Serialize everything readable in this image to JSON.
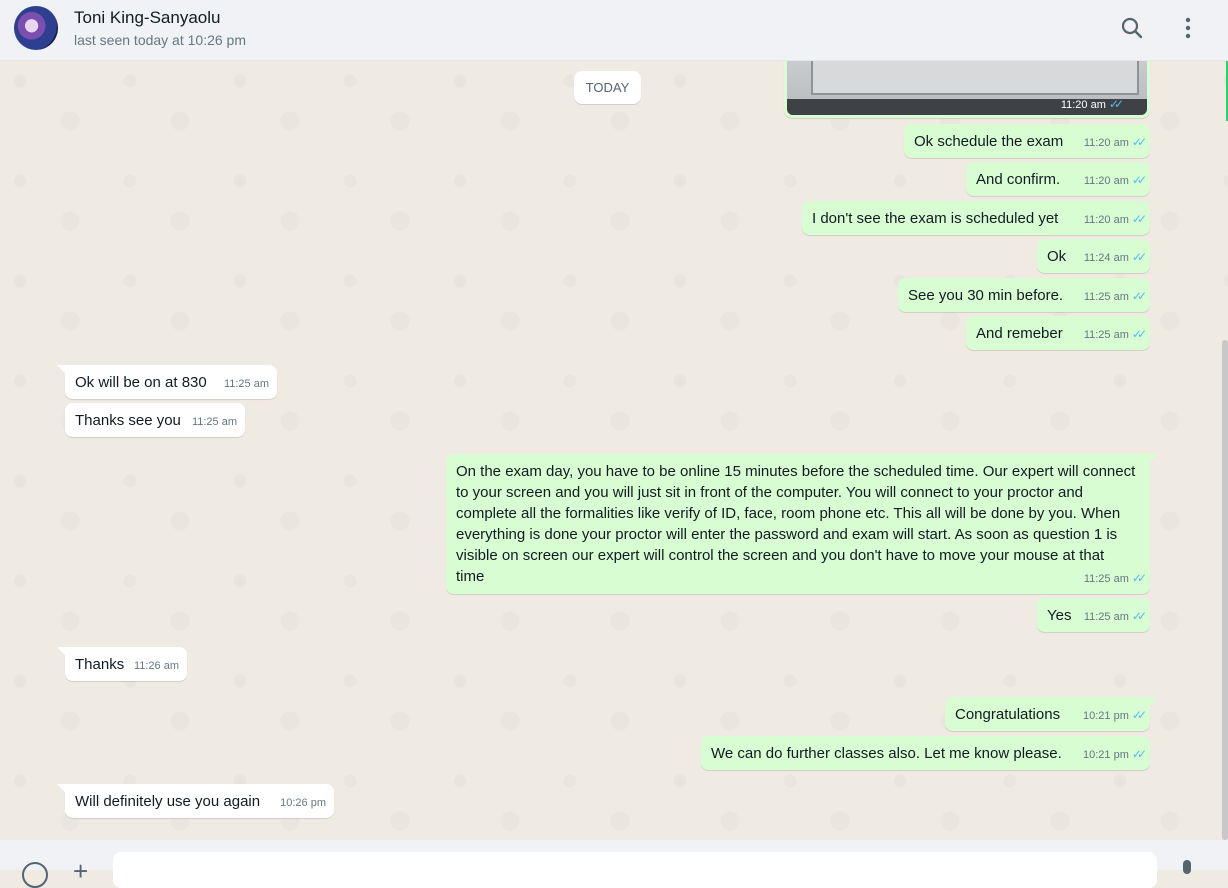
{
  "header": {
    "contact_name": "Toni King-Sanyaolu",
    "status": "last seen today at 10:26 pm"
  },
  "icons": {
    "search": "search-icon",
    "menu": "kebab-menu-icon",
    "ticks": "double-check-icon"
  },
  "colors": {
    "outgoing_bubble": "#d9fdd3",
    "incoming_bubble": "#ffffff",
    "read_ticks": "#53bdeb",
    "chat_bg": "#efeae2"
  },
  "chat": {
    "day_label": "TODAY",
    "image_time": "11:20 am",
    "messages": [
      {
        "dir": "out",
        "text": "Ok schedule the exam",
        "time": "11:20 am"
      },
      {
        "dir": "out",
        "text": "And confirm.",
        "time": "11:20 am"
      },
      {
        "dir": "out",
        "text": "I don't see the exam is scheduled yet",
        "time": "11:20 am"
      },
      {
        "dir": "out",
        "text": "Ok",
        "time": "11:24 am"
      },
      {
        "dir": "out",
        "text": "See you 30 min before.",
        "time": "11:25 am"
      },
      {
        "dir": "out",
        "text": "And remeber",
        "time": "11:25 am"
      },
      {
        "dir": "in",
        "text": "Ok will be on at 830",
        "time": "11:25 am"
      },
      {
        "dir": "in",
        "text": "Thanks see you",
        "time": "11:25 am"
      },
      {
        "dir": "out",
        "text": "On the exam day, you have to be online 15 minutes before the scheduled time. Our expert will connect to your screen and you will just sit in front of the computer. You will connect to your proctor and complete all the formalities like verify of ID, face, room phone etc. This all will be done by you. When everything is done your proctor will enter the password and exam will start. As soon as question 1 is visible on screen our expert will control the screen and you don't have to move your mouse at that time",
        "time": "11:25 am"
      },
      {
        "dir": "out",
        "text": "Yes",
        "time": "11:25 am"
      },
      {
        "dir": "in",
        "text": "Thanks",
        "time": "11:26 am"
      },
      {
        "dir": "out",
        "text": "Congratulations",
        "time": "10:21 pm"
      },
      {
        "dir": "out",
        "text": "We can do further classes also. Let me know please.",
        "time": "10:21 pm"
      },
      {
        "dir": "in",
        "text": "Will definitely use you again",
        "time": "10:26 pm"
      }
    ]
  }
}
